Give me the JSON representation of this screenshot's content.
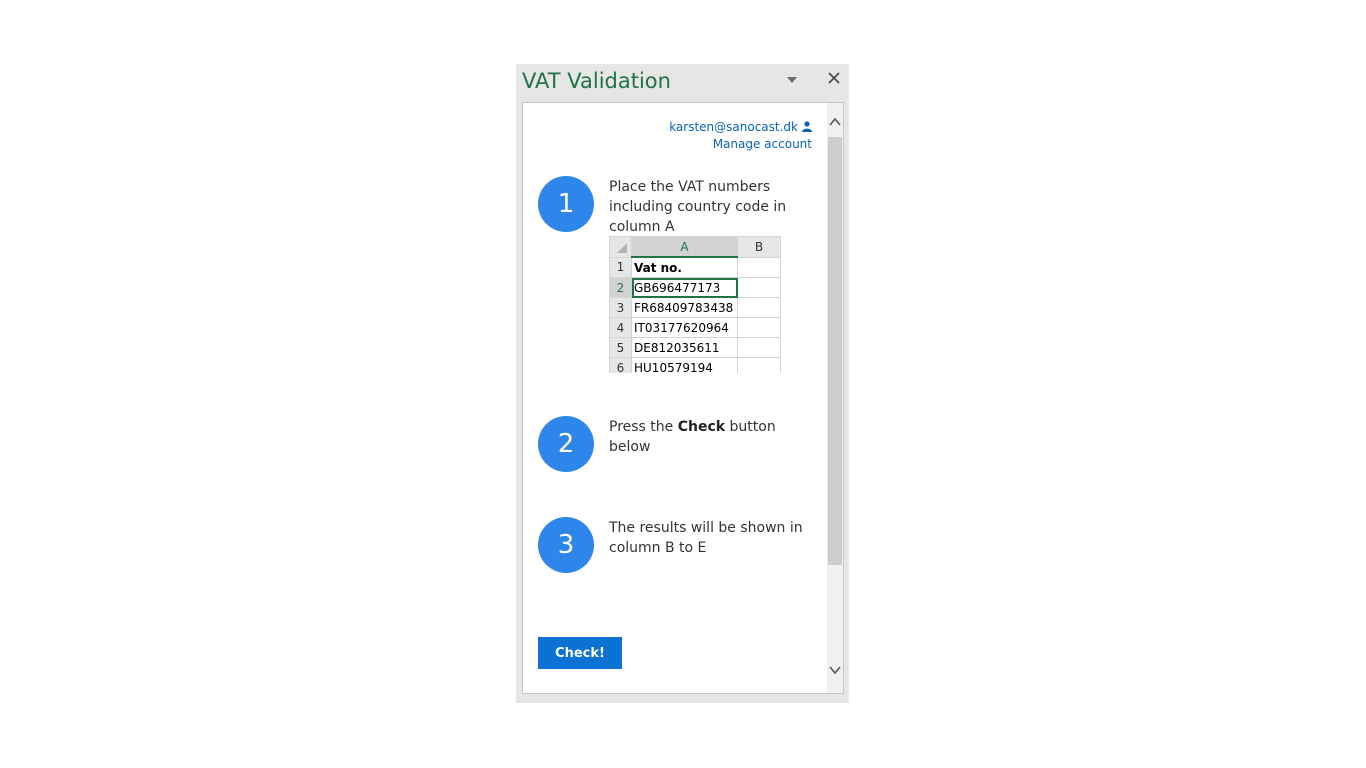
{
  "pane": {
    "title": "VAT Validation",
    "menu_icon": "chevron-down-icon",
    "close_icon": "close-icon"
  },
  "account": {
    "email": "karsten@sanocast.dk",
    "manage_label": "Manage account",
    "icon": "user-icon"
  },
  "steps": [
    {
      "number": "1",
      "text": "Place the VAT numbers including country code in column A"
    },
    {
      "number": "2",
      "text_before": "Press the ",
      "text_bold": "Check",
      "text_after": " button below"
    },
    {
      "number": "3",
      "text": "The results will be shown in column B to E"
    }
  ],
  "sheet": {
    "columns": [
      "A",
      "B"
    ],
    "rows": [
      {
        "num": "1",
        "a": "Vat no."
      },
      {
        "num": "2",
        "a": "GB696477173"
      },
      {
        "num": "3",
        "a": "FR68409783438"
      },
      {
        "num": "4",
        "a": "IT03177620964"
      },
      {
        "num": "5",
        "a": "DE812035611"
      },
      {
        "num": "6",
        "a": "HU10579194"
      }
    ]
  },
  "check_button": {
    "label": "Check!"
  },
  "colors": {
    "accent": "#2e86eb",
    "button": "#0b72d4",
    "excel_green": "#217346",
    "link": "#0b63b8"
  }
}
